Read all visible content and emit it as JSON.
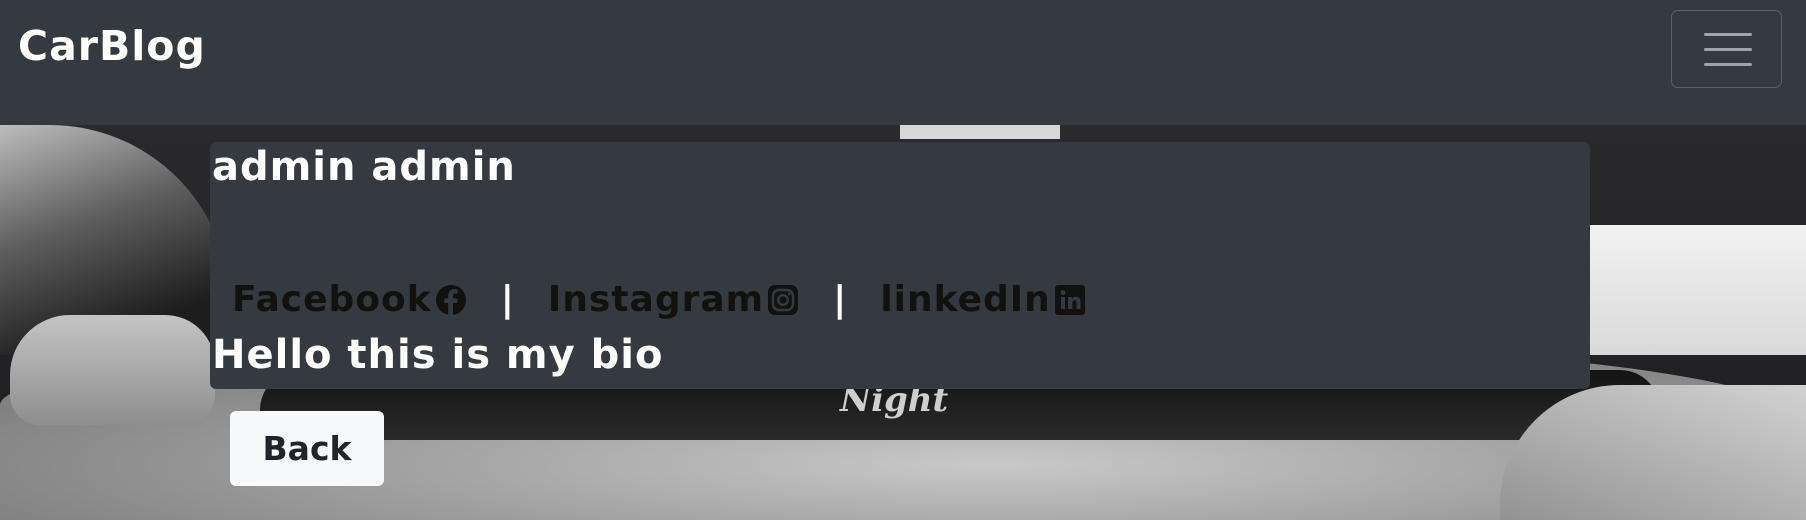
{
  "navbar": {
    "brand": "CarBlog",
    "toggler_icon": "hamburger-menu-icon"
  },
  "profile": {
    "name": "admin admin",
    "social_links": [
      {
        "label": "Facebook",
        "icon": "facebook-icon"
      },
      {
        "label": "Instagram",
        "icon": "instagram-icon"
      },
      {
        "label": "linkedIn",
        "icon": "linkedin-icon"
      }
    ],
    "separator": "|",
    "bio": "Hello this is my bio"
  },
  "actions": {
    "back_label": "Back"
  },
  "background": {
    "sticker_text": "Night"
  },
  "colors": {
    "navbar_bg": "#343a40",
    "card_bg": "#343a40",
    "brand_text": "#ffffff",
    "link_text": "#111111",
    "button_bg": "#f8f9fa"
  }
}
